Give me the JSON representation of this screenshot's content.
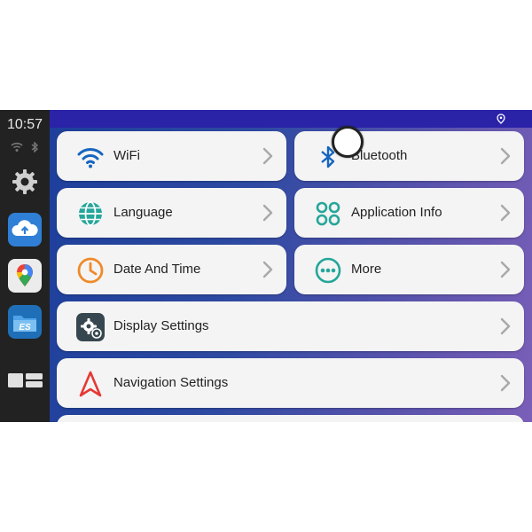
{
  "status": {
    "time": "10:57"
  },
  "dock": {
    "apps": [
      {
        "icon": "gear-icon"
      },
      {
        "icon": "cloud-upload-icon"
      },
      {
        "icon": "maps-icon"
      },
      {
        "icon": "file-manager-icon"
      },
      {
        "icon": "split-screen-icon"
      }
    ]
  },
  "settings": {
    "wifi": {
      "label": "WiFi",
      "icon": "wifi-icon"
    },
    "bluetooth": {
      "label": "Bluetooth",
      "icon": "bluetooth-icon"
    },
    "language": {
      "label": "Language",
      "icon": "globe-icon"
    },
    "application_info": {
      "label": "Application Info",
      "icon": "apps-grid-icon"
    },
    "date_time": {
      "label": "Date And Time",
      "icon": "clock-icon"
    },
    "more": {
      "label": "More",
      "icon": "more-icon"
    },
    "display": {
      "label": "Display Settings",
      "icon": "display-settings-icon"
    },
    "navigation": {
      "label": "Navigation Settings",
      "icon": "navigation-icon"
    }
  },
  "colors": {
    "accent_blue": "#1565c0",
    "accent_teal": "#26a69a",
    "accent_orange": "#ef8a2a",
    "accent_red": "#e53935",
    "background_gradient": [
      "#1d3f9b",
      "#7a5fb8"
    ]
  }
}
